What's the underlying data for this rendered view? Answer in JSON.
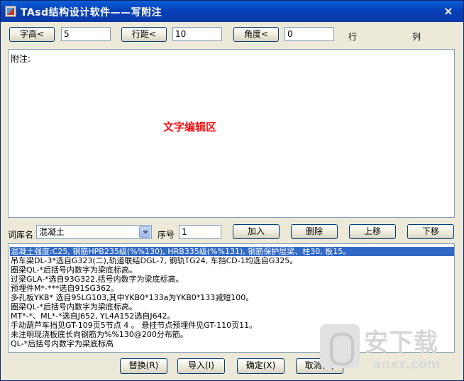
{
  "window": {
    "title": "TAsd结构设计软件——写附注",
    "close_glyph": "×"
  },
  "toolbar": {
    "char_height_button": "字高<",
    "char_height_value": "5",
    "line_spacing_button": "行距<",
    "line_spacing_value": "10",
    "angle_button": "角度<",
    "angle_value": "0",
    "row_label": "行",
    "column_label": "列"
  },
  "editor": {
    "label": "附注:",
    "hint": "文字编辑区"
  },
  "library": {
    "name_label": "词库名",
    "selected": "混凝土",
    "seq_label": "序号",
    "seq_value": "1",
    "add_button": "加入",
    "delete_button": "删除",
    "up_button": "上移",
    "down_button": "下移"
  },
  "entries": [
    "混凝土强度:C25, 钢筋HPB235级(%%130), HRB335级(%%131), 钢筋保护层梁、柱30, 板15。",
    "吊车梁DL-3*选自G323(二),轨道联结DGL-7, 钢轨TG24, 车挡CD-1均选自G325。",
    "圈梁QL-*后括号内数字为梁底标高。",
    "过梁GLA-*选自93G322,括号内数字为梁底标高。",
    "预埋件M*-***选自91SG362。",
    "多孔板YKB* 选自95LG103,其中YKB0*133a为YKB0*133减短100。",
    "圈梁QL-*后括号内数字为梁底标高。",
    "MT*-*、ML*-*选自J652, YL4A152选自J642。",
    "手动葫芦车挡见GT-109页5节点 4 。 悬挂节点预埋件见GT-110页11。",
    "未注明现浇板底长向钢筋为%%130@200分布筋。",
    "QL-*后括号内数字为梁底标高"
  ],
  "footer": {
    "replace_button": "替换(R)",
    "import_button": "导入(I)",
    "ok_button": "确定(X)",
    "cancel_button": "取消(C)"
  },
  "watermark": {
    "text_cn": "安下载",
    "text_en": "anxz.com"
  },
  "colors": {
    "title_bar": "#0a46bf",
    "selection": "#316ac5",
    "hint_text": "#ee1111",
    "dialog_bg": "#ece9d8"
  }
}
